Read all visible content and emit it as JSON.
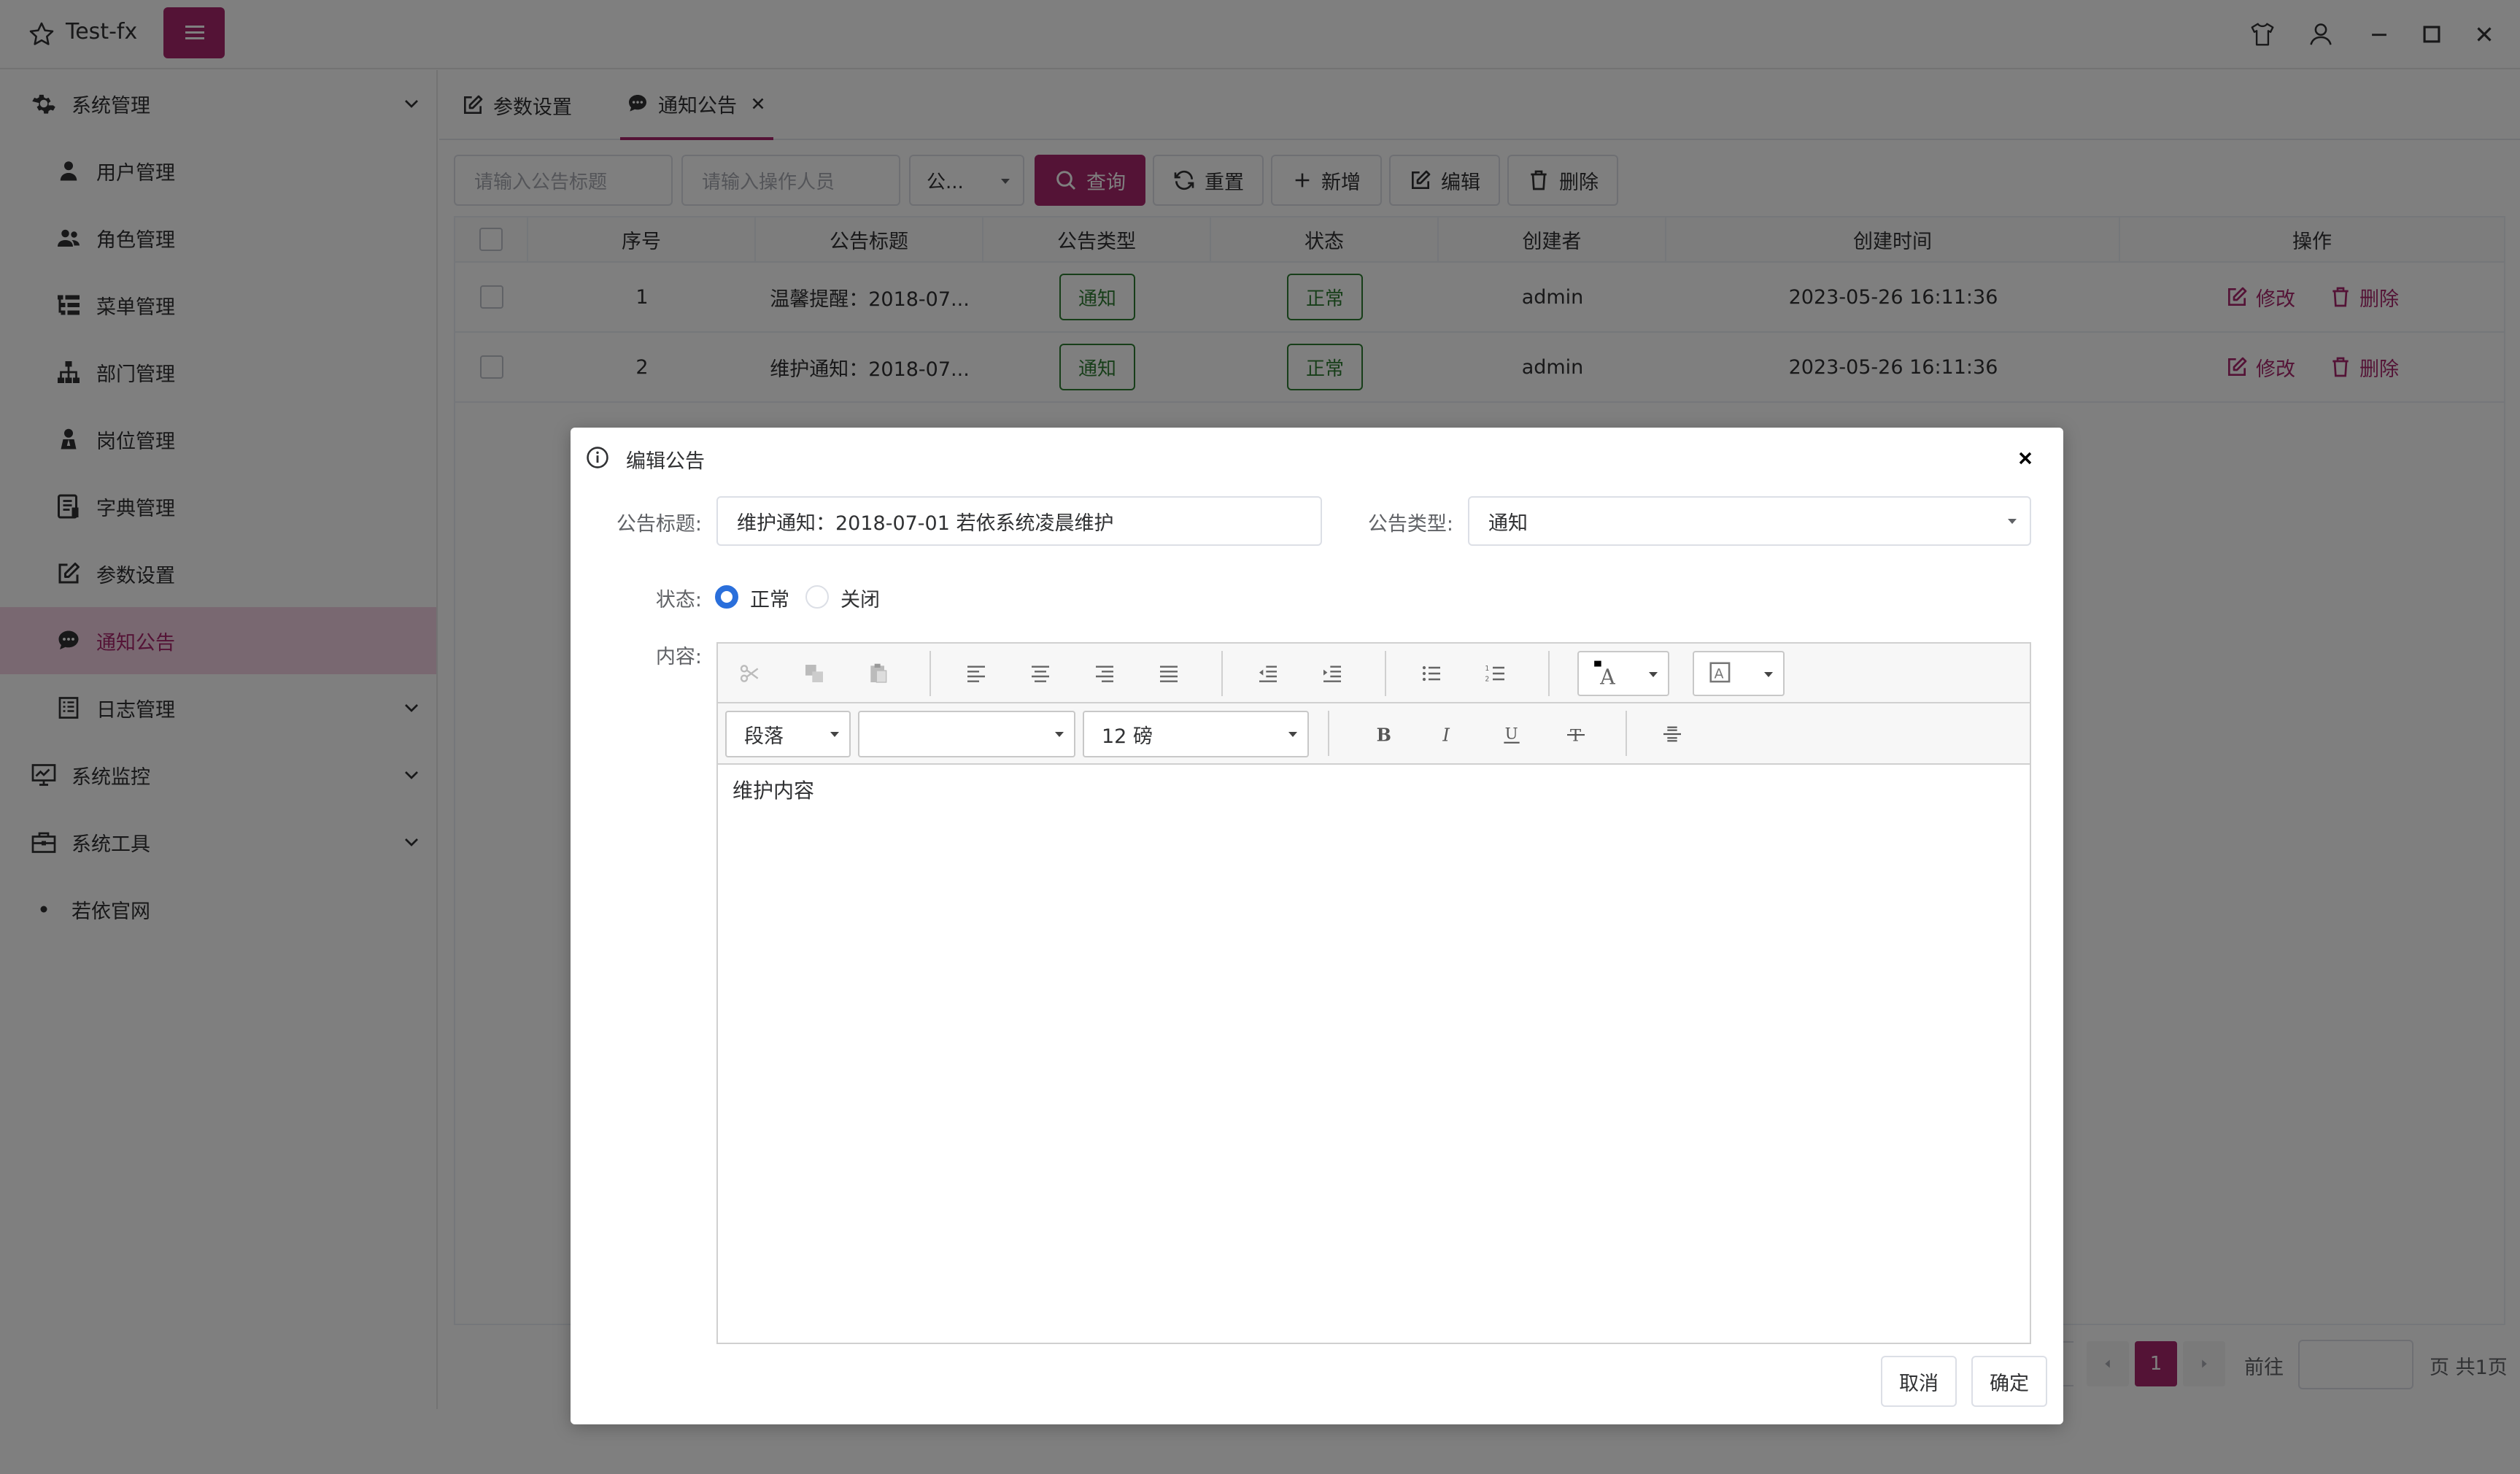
{
  "app": {
    "title": "Test-fx"
  },
  "sidebar": {
    "items": [
      {
        "label": "系统管理",
        "icon": "gear-icon"
      },
      {
        "label": "用户管理",
        "icon": "user-icon"
      },
      {
        "label": "角色管理",
        "icon": "users-icon"
      },
      {
        "label": "菜单管理",
        "icon": "menu-tree-icon"
      },
      {
        "label": "部门管理",
        "icon": "org-icon"
      },
      {
        "label": "岗位管理",
        "icon": "post-icon"
      },
      {
        "label": "字典管理",
        "icon": "dict-icon"
      },
      {
        "label": "参数设置",
        "icon": "edit-icon"
      },
      {
        "label": "通知公告",
        "icon": "chat-icon"
      },
      {
        "label": "日志管理",
        "icon": "log-icon"
      },
      {
        "label": "系统监控",
        "icon": "monitor-icon"
      },
      {
        "label": "系统工具",
        "icon": "toolbox-icon"
      },
      {
        "label": "若依官网",
        "icon": "dot-icon"
      }
    ]
  },
  "tabs": [
    {
      "label": "参数设置"
    },
    {
      "label": "通知公告"
    }
  ],
  "toolbar": {
    "title_placeholder": "请输入公告标题",
    "operator_placeholder": "请输入操作人员",
    "type_select": "公...",
    "search_label": "查询",
    "reset_label": "重置",
    "add_label": "新增",
    "edit_label": "编辑",
    "delete_label": "删除"
  },
  "table": {
    "headers": [
      "序号",
      "公告标题",
      "公告类型",
      "状态",
      "创建者",
      "创建时间",
      "操作"
    ],
    "rows": [
      {
        "index": "1",
        "title": "温馨提醒：2018-07...",
        "type": "通知",
        "status": "正常",
        "creator": "admin",
        "created": "2023-05-26 16:11:36",
        "edit": "修改",
        "delete": "删除"
      },
      {
        "index": "2",
        "title": "维护通知：2018-07...",
        "type": "通知",
        "status": "正常",
        "creator": "admin",
        "created": "2023-05-26 16:11:36",
        "edit": "修改",
        "delete": "删除"
      }
    ]
  },
  "pagination": {
    "current": "1",
    "goto_label": "前往",
    "total_label": "页 共1页"
  },
  "dialog": {
    "title": "编辑公告",
    "title_label": "公告标题:",
    "title_value": "维护通知：2018-07-01 若依系统凌晨维护",
    "type_label": "公告类型:",
    "type_value": "通知",
    "status_label": "状态:",
    "status_normal": "正常",
    "status_closed": "关闭",
    "content_label": "内容:",
    "editor": {
      "paragraph": "段落",
      "font_family": "",
      "font_size": "12 磅",
      "content": "维护内容"
    },
    "cancel_label": "取消",
    "confirm_label": "确定"
  },
  "colors": {
    "accent": "#a8276c",
    "success": "#2e7d32",
    "radio": "#2a6fdb"
  }
}
